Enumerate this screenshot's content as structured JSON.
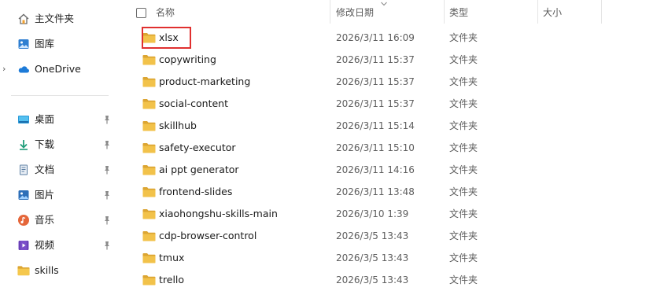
{
  "sidebar": {
    "items": [
      {
        "label": "主文件夹",
        "icon": "home-icon"
      },
      {
        "label": "图库",
        "icon": "gallery-icon"
      },
      {
        "label": "OneDrive",
        "icon": "cloud-icon",
        "expander": "›"
      },
      {
        "label": "桌面",
        "icon": "desktop-icon",
        "pinned": true
      },
      {
        "label": "下载",
        "icon": "download-icon",
        "pinned": true
      },
      {
        "label": "文档",
        "icon": "document-icon",
        "pinned": true
      },
      {
        "label": "图片",
        "icon": "image-icon",
        "pinned": true
      },
      {
        "label": "音乐",
        "icon": "music-icon",
        "pinned": true
      },
      {
        "label": "视频",
        "icon": "video-icon",
        "pinned": true
      },
      {
        "label": "skills",
        "icon": "folder-icon",
        "pinned": false
      }
    ]
  },
  "columns": {
    "name": "名称",
    "modified": "修改日期",
    "type": "类型",
    "size": "大小"
  },
  "files": [
    {
      "name": "xlsx",
      "modified": "2026/3/11 16:09",
      "type": "文件夹",
      "highlighted": true
    },
    {
      "name": "copywriting",
      "modified": "2026/3/11 15:37",
      "type": "文件夹"
    },
    {
      "name": "product-marketing",
      "modified": "2026/3/11 15:37",
      "type": "文件夹"
    },
    {
      "name": "social-content",
      "modified": "2026/3/11 15:37",
      "type": "文件夹"
    },
    {
      "name": "skillhub",
      "modified": "2026/3/11 15:14",
      "type": "文件夹"
    },
    {
      "name": "safety-executor",
      "modified": "2026/3/11 15:10",
      "type": "文件夹"
    },
    {
      "name": "ai ppt generator",
      "modified": "2026/3/11 14:16",
      "type": "文件夹"
    },
    {
      "name": "frontend-slides",
      "modified": "2026/3/11 13:48",
      "type": "文件夹"
    },
    {
      "name": "xiaohongshu-skills-main",
      "modified": "2026/3/10 1:39",
      "type": "文件夹"
    },
    {
      "name": "cdp-browser-control",
      "modified": "2026/3/5 13:43",
      "type": "文件夹"
    },
    {
      "name": "tmux",
      "modified": "2026/3/5 13:43",
      "type": "文件夹"
    },
    {
      "name": "trello",
      "modified": "2026/3/5 13:43",
      "type": "文件夹"
    }
  ],
  "colors": {
    "folder": "#f2c24a",
    "folder_dark": "#dca532",
    "highlight": "#e0302f",
    "cloud": "#1d7bd8"
  }
}
